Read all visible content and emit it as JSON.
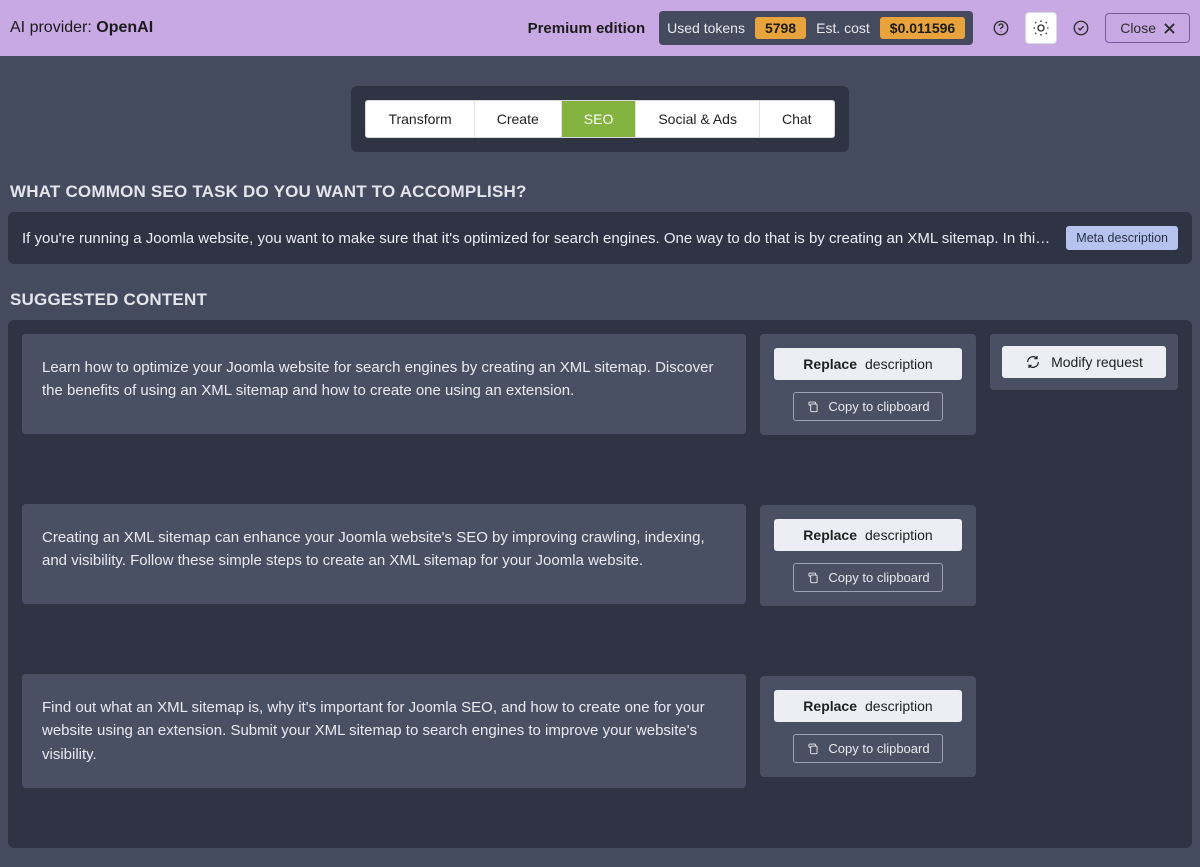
{
  "header": {
    "provider_label": "AI provider: ",
    "provider_name": "OpenAI",
    "premium": "Premium edition",
    "used_tokens_label": "Used tokens",
    "used_tokens_value": "5798",
    "est_cost_label": "Est. cost",
    "est_cost_value": "$0.011596",
    "close_label": "Close"
  },
  "tabs": {
    "items": [
      "Transform",
      "Create",
      "SEO",
      "Social & Ads",
      "Chat"
    ],
    "active_index": 2
  },
  "task": {
    "heading": "WHAT COMMON SEO TASK DO YOU WANT TO ACCOMPLISH?",
    "prompt_text": "If you're running a Joomla website, you want to make sure that it's optimized for search engines. One way to do that is by creating an XML sitemap. In this blog ...",
    "meta_label": "Meta description"
  },
  "suggested": {
    "heading": "SUGGESTED CONTENT",
    "replace_bold": "Replace",
    "replace_rest": " description",
    "copy_label": "Copy to clipboard",
    "modify_label": "Modify request",
    "items": [
      "Learn how to optimize your Joomla website for search engines by creating an XML sitemap. Discover the benefits of using an XML sitemap and how to create one using an extension.",
      "Creating an XML sitemap can enhance your Joomla website's SEO by improving crawling, indexing, and visibility. Follow these simple steps to create an XML sitemap for your Joomla website.",
      "Find out what an XML sitemap is, why it's important for Joomla SEO, and how to create one for your website using an extension. Submit your XML sitemap to search engines to improve your website's visibility."
    ]
  }
}
